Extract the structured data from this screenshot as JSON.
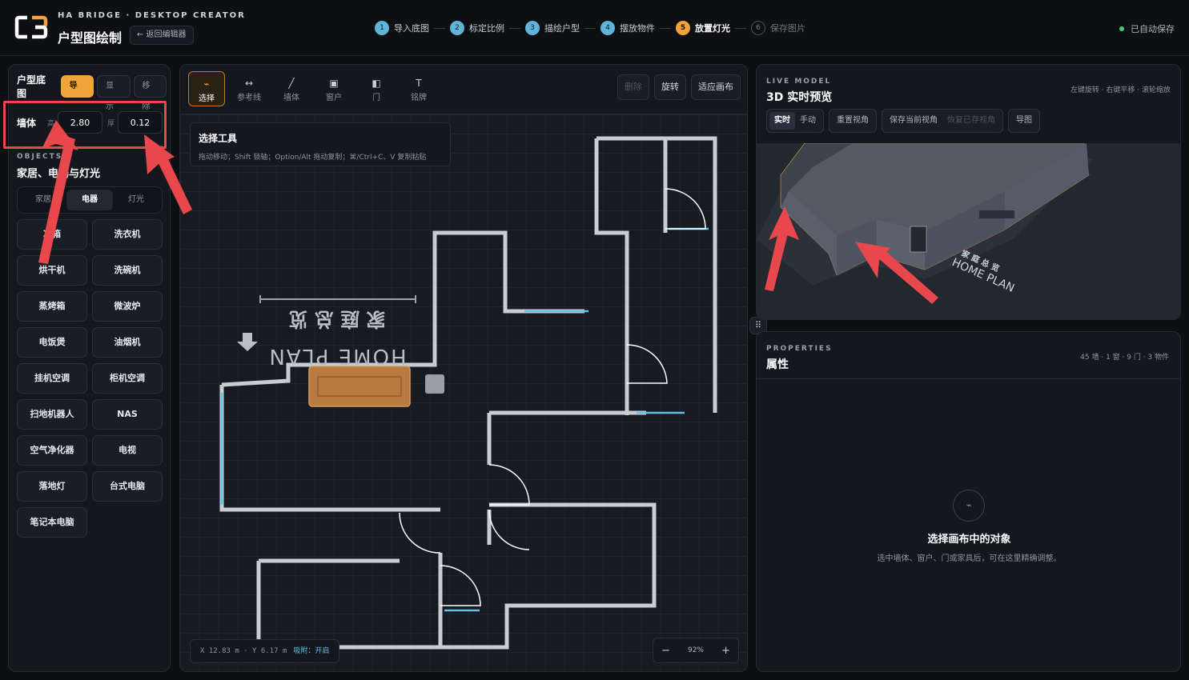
{
  "header": {
    "brand_sub": "HA BRIDGE · DESKTOP CREATOR",
    "brand_title": "户型图绘制",
    "back_label": "← 返回编辑器",
    "steps": [
      {
        "num": "1",
        "label": "导入底图"
      },
      {
        "num": "2",
        "label": "标定比例"
      },
      {
        "num": "3",
        "label": "描绘户型"
      },
      {
        "num": "4",
        "label": "摆放物件"
      },
      {
        "num": "5",
        "label": "放置灯光"
      },
      {
        "num": "6",
        "label": "保存图片"
      }
    ],
    "autosave": "已自动保存"
  },
  "left": {
    "floor_label": "户型底图",
    "floor_buttons": [
      "导入",
      "显示",
      "移除"
    ],
    "wall_label": "墙体",
    "height_label": "高",
    "height_value": "2.80",
    "thick_label": "厚",
    "thick_value": "0.12",
    "objects_sub": "OBJECTS",
    "objects_title": "家居、电器与灯光",
    "tabs": [
      "家居",
      "电器",
      "灯光"
    ],
    "items": [
      "冰箱",
      "洗衣机",
      "烘干机",
      "洗碗机",
      "蒸烤箱",
      "微波炉",
      "电饭煲",
      "油烟机",
      "挂机空调",
      "柜机空调",
      "扫地机器人",
      "NAS",
      "空气净化器",
      "电视",
      "落地灯",
      "台式电脑",
      "笔记本电脑"
    ]
  },
  "canvas": {
    "tools": [
      {
        "icon": "⌁",
        "label": "选择"
      },
      {
        "icon": "↔",
        "label": "参考线"
      },
      {
        "icon": "╱",
        "label": "墙体"
      },
      {
        "icon": "▣",
        "label": "窗户"
      },
      {
        "icon": "◧",
        "label": "门"
      },
      {
        "icon": "T",
        "label": "铭牌"
      }
    ],
    "delete_label": "删除",
    "rotate_label": "旋转",
    "fit_label": "适应画布",
    "tip_title": "选择工具",
    "tip_desc": "拖动移动；Shift 锁轴；Option/Alt 拖动复制；⌘/Ctrl+C、V 复制粘贴",
    "plate_en": "HOME PLAN",
    "plate_cn": "家 庭 总 览",
    "coord_text": "X 12.83 m · Y 6.17 m",
    "snap_text": "吸附：开启",
    "zoom_minus": "−",
    "zoom_value": "92%",
    "zoom_plus": "+"
  },
  "preview": {
    "sub": "LIVE MODEL",
    "title": "3D 实时预览",
    "hint": "左键旋转 · 右键平移 · 滚轮缩放",
    "mode_buttons": [
      "实时",
      "手动"
    ],
    "reset_label": "重置视角",
    "save_view_label": "保存当前视角",
    "restore_view_label": "恢复已存视角",
    "export_label": "导图",
    "plate_cn": "家 庭 总 览",
    "plate_en": "HOME PLAN"
  },
  "properties": {
    "sub": "PROPERTIES",
    "title": "属性",
    "count": "45 墙 · 1 窗 · 9 门 · 3 物件",
    "empty_title": "选择画布中的对象",
    "empty_desc": "选中墙体、窗户、门或家具后，可在这里精确调整。"
  },
  "colors": {
    "accent": "#f0a43a",
    "step": "#5fb4d8",
    "highlight": "#e8474c",
    "ok": "#3ecf7a"
  }
}
